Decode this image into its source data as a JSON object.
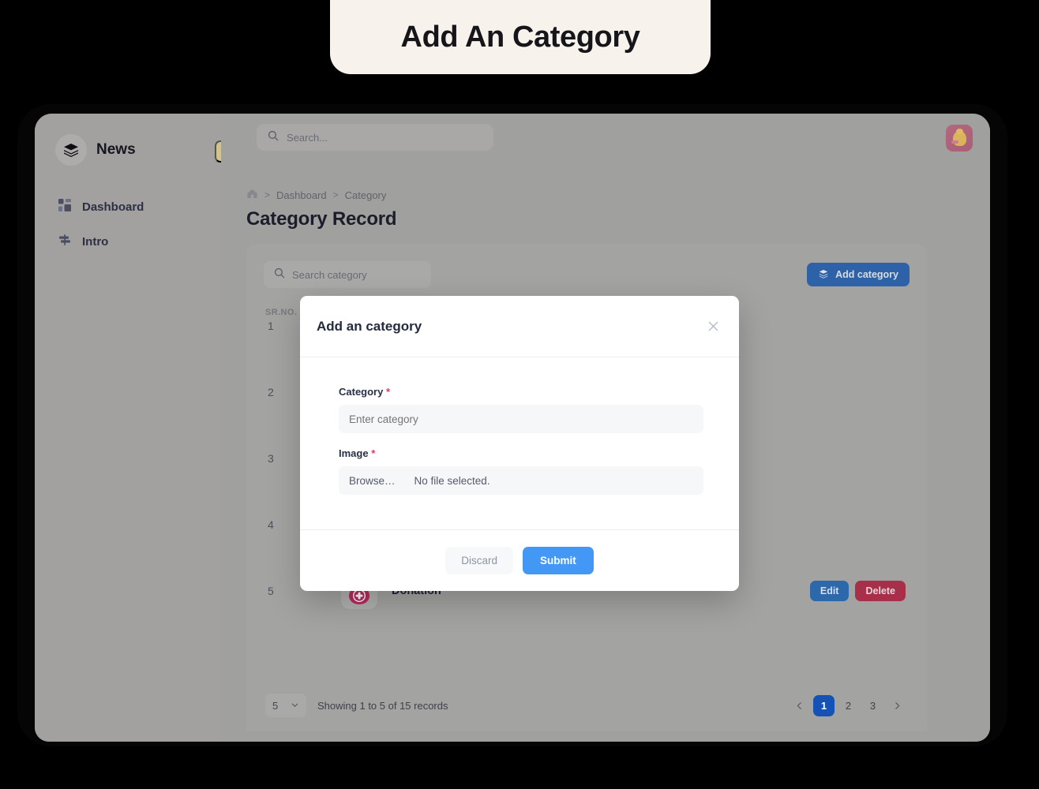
{
  "banner": {
    "title": "Add An Category"
  },
  "sidebar": {
    "brand": {
      "name": "News",
      "logo_icon": "layers-icon"
    },
    "collapse_icon": "collapse-arrow-icon",
    "items": [
      {
        "label": "Dashboard",
        "icon": "grid-icon"
      },
      {
        "label": "Intro",
        "icon": "signpost-icon"
      }
    ]
  },
  "topbar": {
    "search": {
      "placeholder": "Search...",
      "value": "",
      "icon": "search-icon"
    },
    "avatar_label": "user-avatar"
  },
  "page": {
    "breadcrumb": [
      "Dashboard",
      "Category"
    ],
    "home_icon": "home-icon",
    "separator": ">",
    "title": "Category Record"
  },
  "toolbar": {
    "search": {
      "placeholder": "Search category",
      "value": "",
      "icon": "search-icon"
    },
    "add_button": {
      "label": "Add category",
      "icon": "layers-stack-icon",
      "color": "#2d62a8"
    }
  },
  "table": {
    "columns": [
      "SR.NO."
    ],
    "sort_icon": "sort-arrow-icon",
    "rows": [
      {
        "num": "1",
        "name": "",
        "icon": "category-icon"
      },
      {
        "num": "2",
        "name": "",
        "icon": "category-icon"
      },
      {
        "num": "3",
        "name": "",
        "icon": "category-icon"
      },
      {
        "num": "4",
        "name": "",
        "icon": "category-icon"
      },
      {
        "num": "5",
        "name": "Donation",
        "icon": "blood-drop-icon"
      }
    ],
    "actions": {
      "edit_label": "Edit",
      "delete_label": "Delete",
      "edit_color": "#2d68ab",
      "delete_color": "#a82f49"
    }
  },
  "footer": {
    "per_page": "5",
    "per_page_chevron": "chevron-down-icon",
    "showing": "Showing 1 to 5 of 15 records",
    "pager": {
      "prev_icon": "chevron-left-icon",
      "next_icon": "chevron-right-icon",
      "pages": [
        "1",
        "2",
        "3"
      ],
      "active": "1",
      "active_color": "#1452b5"
    }
  },
  "modal": {
    "title": "Add an category",
    "close_icon": "close-icon",
    "fields": {
      "category": {
        "label": "Category",
        "required_mark": "*",
        "placeholder": "Enter category",
        "value": ""
      },
      "image": {
        "label": "Image",
        "required_mark": "*",
        "browse_label": "Browse…",
        "file_status": "No file selected."
      }
    },
    "buttons": {
      "discard": "Discard",
      "submit": "Submit",
      "submit_color": "#4398f5"
    }
  }
}
